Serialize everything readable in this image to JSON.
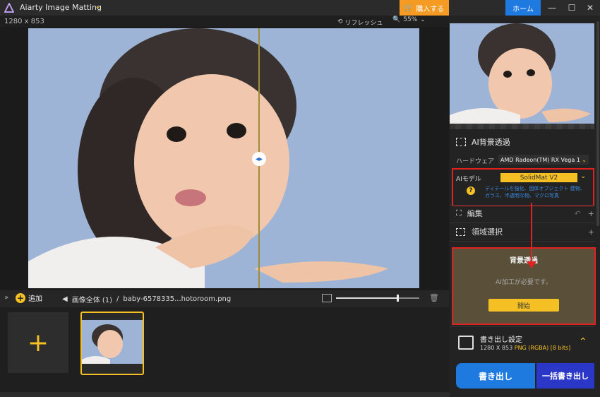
{
  "app": {
    "title": "Aiarty Image Matting"
  },
  "titlebar": {
    "buy_label": "購入する",
    "home_label": "ホーム"
  },
  "canvas": {
    "dimensions": "1280 x 853",
    "refresh_label": "リフレッシュ",
    "zoom": "55%"
  },
  "strip": {
    "add_label": "追加",
    "crumb_all": "画像全体 (1)",
    "crumb_sep": "/",
    "crumb_file": "baby-6578335...hotoroom.png"
  },
  "panel": {
    "bg_remove_title": "AI背景透過",
    "hardware_label": "ハードウェア",
    "hardware_value": "AMD Radeon(TM) RX Vega 1",
    "model_label": "AIモデル",
    "model_value": "SolidMat  V2",
    "model_desc": "ディテールを強化、固体オブジェクト 建物、ガラス、半透明な物、マクロ写真",
    "edit_label": "編集",
    "region_label": "領域選択",
    "bgt_title": "背景透過",
    "bgt_msg": "AI加工が必要です。",
    "bgt_start": "開始",
    "export_title": "書き出し設定",
    "export_size": "1280 X 853",
    "export_format": "PNG (RGBA) [8 bits]",
    "export_button": "書き出し",
    "batch_button": "一括書き出し"
  },
  "colors": {
    "accent": "#f5c024",
    "primary": "#1f7ae0",
    "highlight": "#e02222"
  }
}
